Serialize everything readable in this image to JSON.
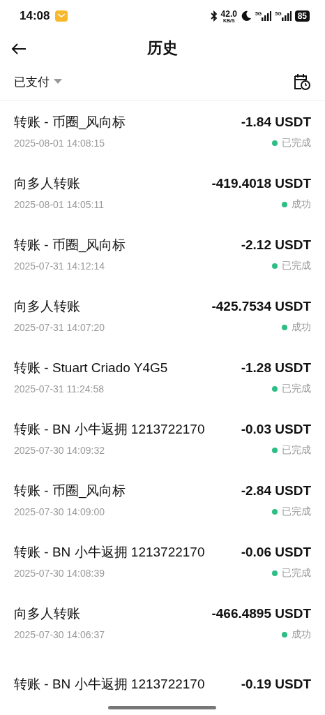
{
  "status_bar": {
    "time": "14:08",
    "net_speed": "42.0",
    "net_unit": "KB/S",
    "signal_1": "5G",
    "signal_2": "5G",
    "battery": "85"
  },
  "header": {
    "title": "历史"
  },
  "filter": {
    "label": "已支付"
  },
  "transactions": [
    {
      "title": "转账 - 币圈_风向标",
      "amount": "-1.84 USDT",
      "date": "2025-08-01 14:08:15",
      "status": "已完成"
    },
    {
      "title": "向多人转账",
      "amount": "-419.4018 USDT",
      "date": "2025-08-01 14:05:11",
      "status": "成功"
    },
    {
      "title": "转账 - 币圈_风向标",
      "amount": "-2.12 USDT",
      "date": "2025-07-31 14:12:14",
      "status": "已完成"
    },
    {
      "title": "向多人转账",
      "amount": "-425.7534 USDT",
      "date": "2025-07-31 14:07:20",
      "status": "成功"
    },
    {
      "title": "转账 - Stuart Criado Y4G5",
      "amount": "-1.28 USDT",
      "date": "2025-07-31 11:24:58",
      "status": "已完成"
    },
    {
      "title": "转账 - BN 小牛返拥 1213722170",
      "amount": "-0.03 USDT",
      "date": "2025-07-30 14:09:32",
      "status": "已完成"
    },
    {
      "title": "转账 - 币圈_风向标",
      "amount": "-2.84 USDT",
      "date": "2025-07-30 14:09:00",
      "status": "已完成"
    },
    {
      "title": "转账 - BN 小牛返拥 1213722170",
      "amount": "-0.06 USDT",
      "date": "2025-07-30 14:08:39",
      "status": "已完成"
    },
    {
      "title": "向多人转账",
      "amount": "-466.4895 USDT",
      "date": "2025-07-30 14:06:37",
      "status": "成功"
    },
    {
      "title": "转账 - BN 小牛返拥 1213722170",
      "amount": "-0.19 USDT"
    }
  ]
}
